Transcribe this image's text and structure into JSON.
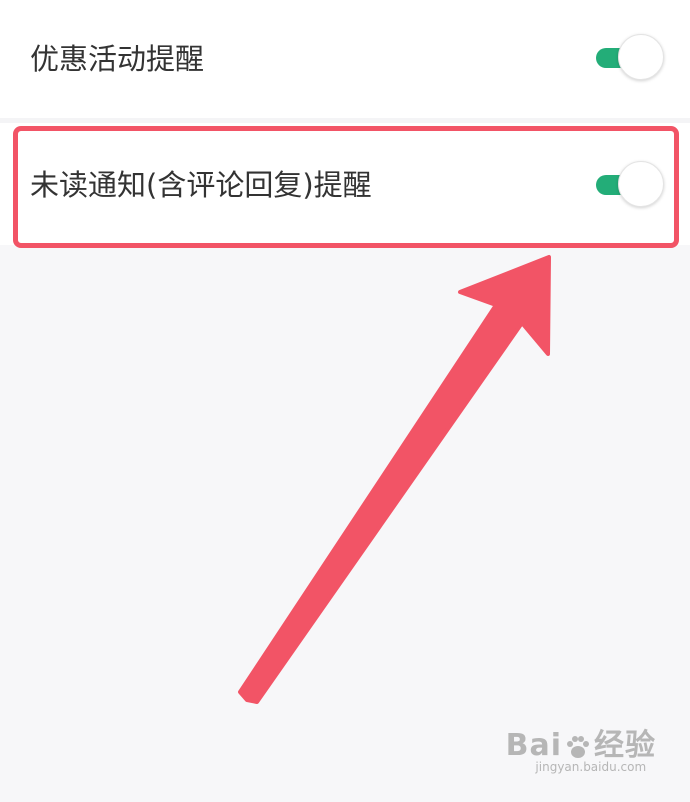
{
  "settings": {
    "items": [
      {
        "label": "优惠活动提醒",
        "enabled": true
      },
      {
        "label": "未读通知(含评论回复)提醒",
        "enabled": true
      }
    ]
  },
  "colors": {
    "toggle_on": "#23ad78",
    "annotation": "#f25466",
    "background": "#f7f7f9"
  },
  "annotation": {
    "highlighted_item": "未读通知(含评论回复)提醒"
  },
  "watermark": {
    "brand_left": "Bai",
    "brand_right": "经验",
    "url": "jingyan.baidu.com"
  }
}
